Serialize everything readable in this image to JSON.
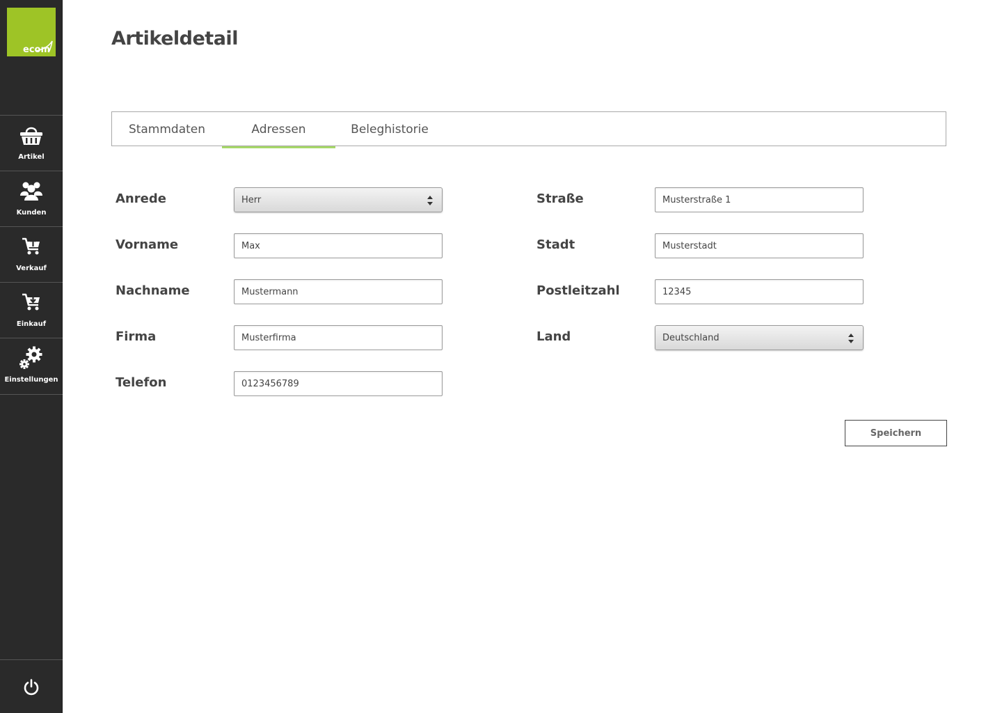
{
  "brand": {
    "logo_text": "ecom",
    "accent_color": "#9ec426"
  },
  "sidebar": {
    "items": [
      {
        "label": "Artikel",
        "icon": "basket-icon"
      },
      {
        "label": "Kunden",
        "icon": "users-icon"
      },
      {
        "label": "Verkauf",
        "icon": "cart-upload-icon"
      },
      {
        "label": "Einkauf",
        "icon": "cart-download-icon"
      },
      {
        "label": "Einstellungen",
        "icon": "gears-icon"
      }
    ],
    "logout_icon": "power-icon"
  },
  "page": {
    "title": "Artikeldetail"
  },
  "tabs": {
    "items": [
      {
        "label": "Stammdaten"
      },
      {
        "label": "Adressen"
      },
      {
        "label": "Beleghistorie"
      }
    ],
    "active": "Adressen",
    "active_color": "#a6d868"
  },
  "form": {
    "anrede": {
      "label": "Anrede",
      "value": "Herr"
    },
    "vorname": {
      "label": "Vorname",
      "value": "Max"
    },
    "nachname": {
      "label": "Nachname",
      "value": "Mustermann"
    },
    "firma": {
      "label": "Firma",
      "value": "Musterfirma"
    },
    "telefon": {
      "label": "Telefon",
      "value": "0123456789"
    },
    "strasse": {
      "label": "Straße",
      "value": "Musterstraße 1"
    },
    "stadt": {
      "label": "Stadt",
      "value": "Musterstadt"
    },
    "plz": {
      "label": "Postleitzahl",
      "value": "12345"
    },
    "land": {
      "label": "Land",
      "value": "Deutschland"
    }
  },
  "actions": {
    "save_label": "Speichern"
  }
}
